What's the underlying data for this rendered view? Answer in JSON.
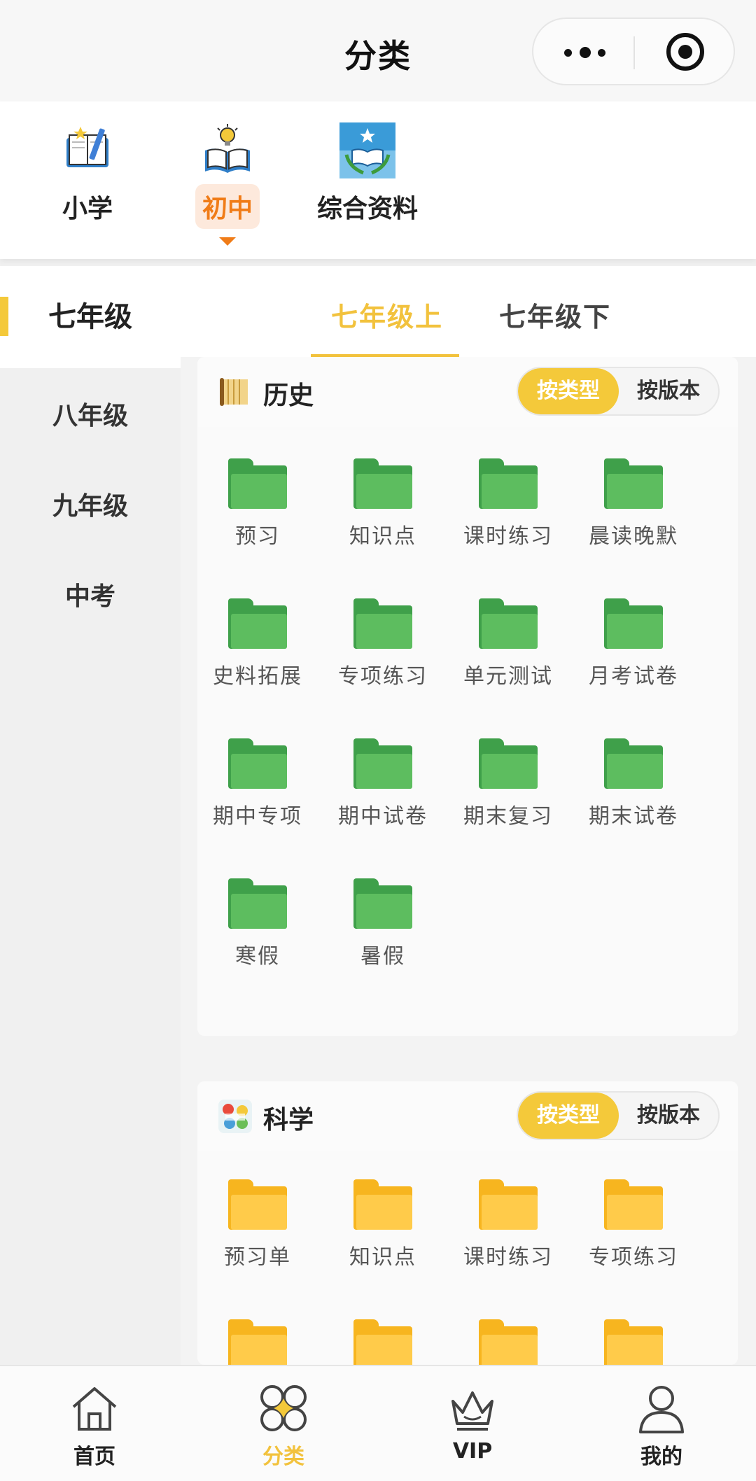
{
  "header": {
    "title": "分类",
    "more_icon": "more-icon",
    "record_icon": "record-icon"
  },
  "levels": [
    {
      "label": "小学",
      "icon": "pencil-book-icon",
      "active": false
    },
    {
      "label": "初中",
      "icon": "bulb-book-icon",
      "active": true
    },
    {
      "label": "综合资料",
      "icon": "school-book-icon",
      "active": false
    }
  ],
  "sidebar": {
    "items": [
      {
        "label": "七年级",
        "active": true
      },
      {
        "label": "八年级",
        "active": false
      },
      {
        "label": "九年级",
        "active": false
      },
      {
        "label": "中考",
        "active": false
      }
    ]
  },
  "grade_tabs": [
    {
      "label": "七年级上",
      "active": true
    },
    {
      "label": "七年级下",
      "active": false
    }
  ],
  "sections": [
    {
      "title": "历史",
      "icon": "scroll-icon",
      "seg_on": "按类型",
      "seg_off": "按版本",
      "folder_color": "#5dbd5f",
      "items": [
        "预习",
        "知识点",
        "课时练习",
        "晨读晚默",
        "史料拓展",
        "专项练习",
        "单元测试",
        "月考试卷",
        "期中专项",
        "期中试卷",
        "期末复习",
        "期末试卷",
        "寒假",
        "暑假"
      ]
    },
    {
      "title": "科学",
      "icon": "science-icon",
      "seg_on": "按类型",
      "seg_off": "按版本",
      "folder_color": "#ffcb4a",
      "items": [
        "预习单",
        "知识点",
        "课时练习",
        "专项练习"
      ]
    }
  ],
  "bottom_nav": [
    {
      "label": "首页",
      "icon": "home-icon",
      "active": false
    },
    {
      "label": "分类",
      "icon": "category-icon",
      "active": true
    },
    {
      "label": "VIP",
      "icon": "crown-icon",
      "active": false
    },
    {
      "label": "我的",
      "icon": "user-icon",
      "active": false
    }
  ],
  "colors": {
    "accent_yellow": "#f2c23d",
    "accent_orange": "#f07c18",
    "folder_green": "#5dbd5f",
    "folder_yellow": "#ffcb4a"
  }
}
